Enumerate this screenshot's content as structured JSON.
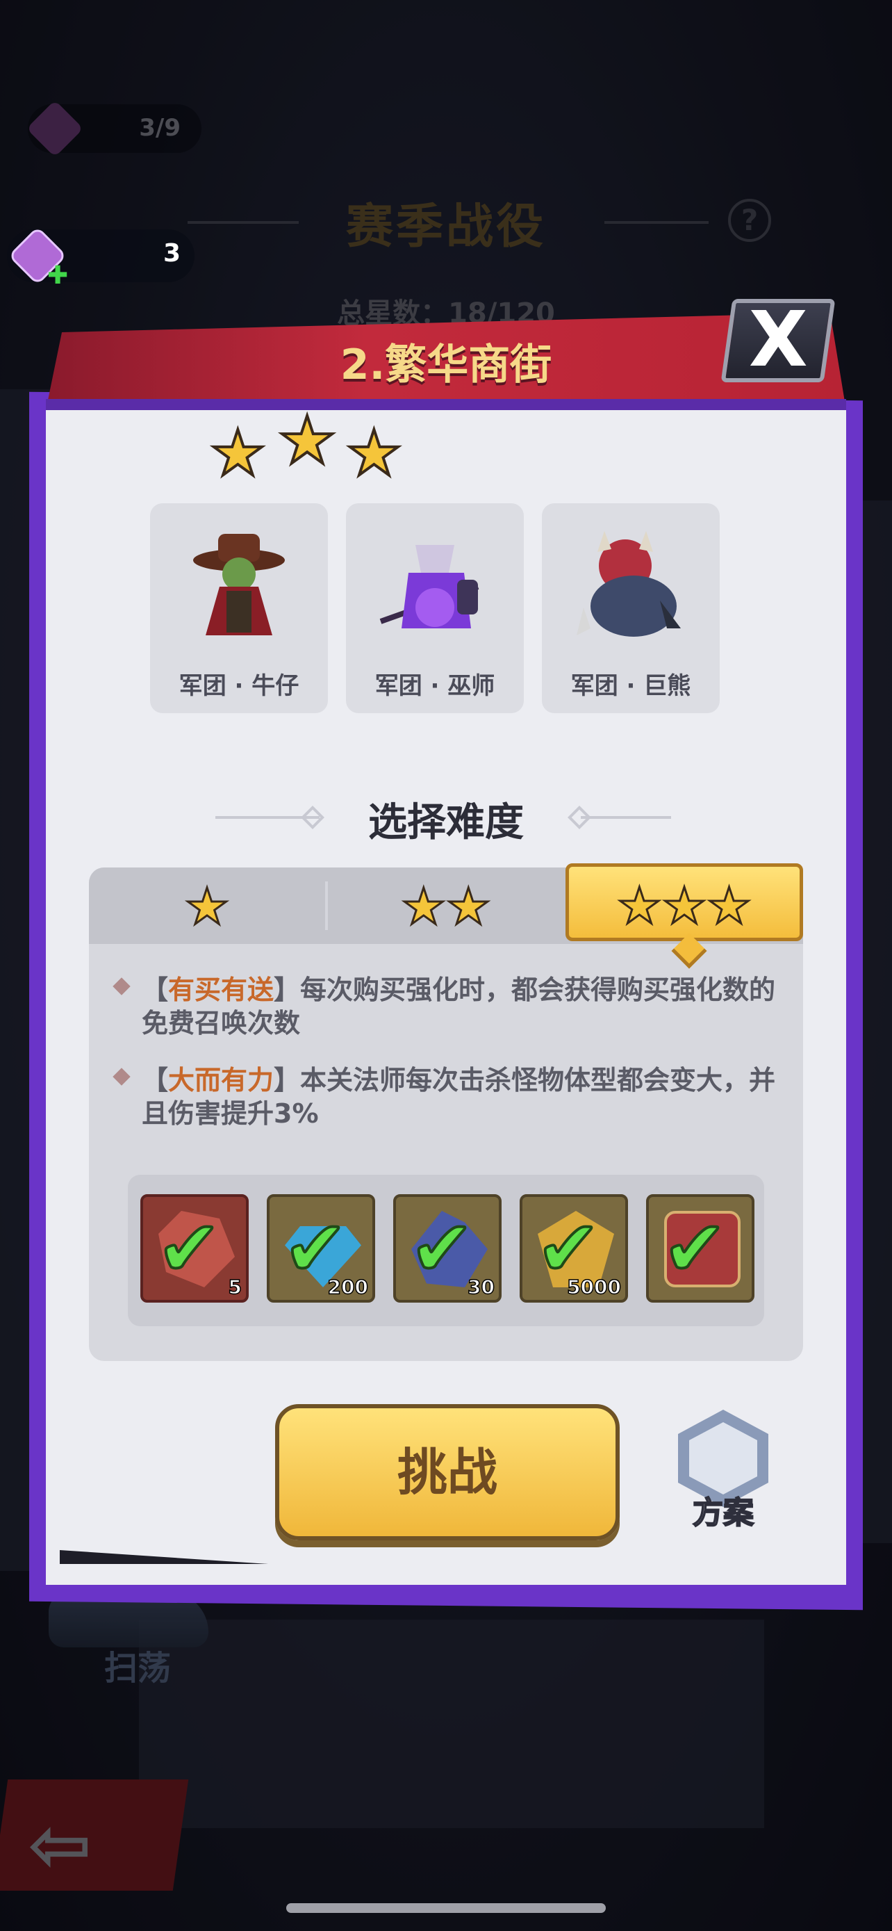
{
  "hud": {
    "counter_top": "3/9",
    "summon_count": "3",
    "season_title": "赛季战役",
    "total_stars": "总星数：18/120",
    "sweep_label": "扫荡"
  },
  "modal": {
    "title": "2.繁华商街",
    "close_label": "X",
    "earned_stars": 3,
    "units": [
      {
        "name": "军团 · 牛仔",
        "icon": "cowboy-goblin-icon",
        "color": "#6a2a28"
      },
      {
        "name": "军团 · 巫师",
        "icon": "purple-wizard-icon",
        "color": "#7b3ad8"
      },
      {
        "name": "军团 · 巨熊",
        "icon": "red-bear-icon",
        "color": "#b2303e"
      }
    ],
    "difficulty": {
      "title": "选择难度",
      "tabs": [
        {
          "stars": "★",
          "selected": false
        },
        {
          "stars": "★★",
          "selected": false
        },
        {
          "stars": "★★★",
          "selected": true
        }
      ],
      "rules": [
        {
          "open": "【",
          "highlight": "有买有送",
          "close": "】",
          "text": "每次购买强化时，都会获得购买强化数的免费召唤次数"
        },
        {
          "open": "【",
          "highlight": "大而有力",
          "close": "】",
          "text": "本关法师每次击杀怪物体型都会变大，并且伤害提升3%"
        }
      ],
      "rewards": [
        {
          "icon": "red-ore-icon",
          "count": "5",
          "claimed": true,
          "color": "#c0554a"
        },
        {
          "icon": "blue-gem-icon",
          "count": "200",
          "claimed": true,
          "color": "#3aa6d8"
        },
        {
          "icon": "purple-crystal-icon",
          "count": "30",
          "claimed": true,
          "color": "#4a5aa8"
        },
        {
          "icon": "gold-wing-icon",
          "count": "5000",
          "claimed": true,
          "color": "#d8a83a"
        },
        {
          "icon": "red-book-icon",
          "count": "",
          "claimed": true,
          "color": "#a83a3a"
        }
      ]
    },
    "challenge_label": "挑战",
    "plan_label": "方案"
  },
  "colors": {
    "accent_gold": "#f4bd3c",
    "header_red": "#c22a3c",
    "frame_purple": "#6a34c8"
  }
}
